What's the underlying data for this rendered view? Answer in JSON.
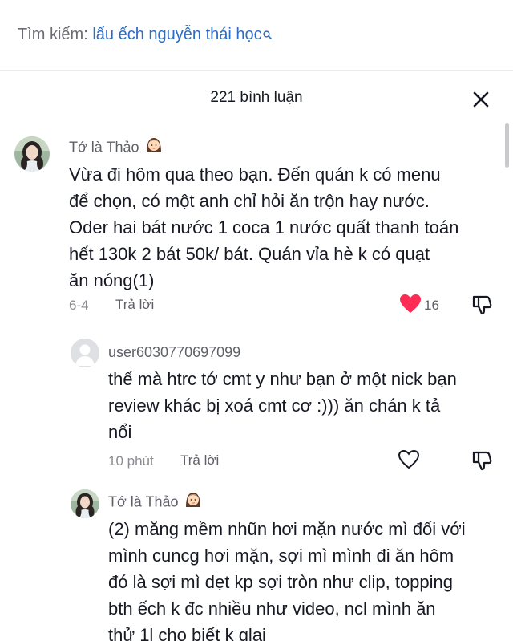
{
  "search": {
    "prefix": "Tìm kiếm: ",
    "query": "lẩu ếch nguyễn thái học",
    "icon": "search-icon"
  },
  "comments_sheet": {
    "title": "221 bình luận",
    "close_icon": "close-icon"
  },
  "comments": [
    {
      "author": "Tớ là Thảo",
      "author_badge_icon": "girl-face-emoji-icon",
      "text_lines": [
        "Vừa đi hôm qua theo bạn. Đến quán k có menu",
        "để chọn, có một anh chỉ hỏi ăn trộn hay nước.",
        "Oder hai bát nước 1 coca 1 nước quất thanh toán",
        "hết 130k 2 bát 50k/ bát. Quán vỉa hè k có quạt",
        "ăn nóng(1)"
      ],
      "date": "6-4",
      "reply_label": "Trả lời",
      "like_count": "16",
      "liked": true,
      "like_color": "#fe2c55"
    },
    {
      "author": "user6030770697099",
      "text_lines": [
        "thế mà htrc tớ cmt y như bạn ở một nick bạn",
        "review khác bị xoá cmt cơ :))) ăn chán k tả",
        "nổi"
      ],
      "date": "10 phút",
      "reply_label": "Trả lời",
      "liked": false
    },
    {
      "author": "Tớ là Thảo",
      "author_badge_icon": "girl-face-emoji-icon",
      "text_lines": [
        "(2) măng mềm nhũn hơi mặn nước mì đối với",
        "mình cuncg hơi mặn, sợi mì mình đi ăn hôm",
        "đó là sợi mì dẹt kp sợi tròn như clip, topping",
        "bth ếch k đc nhiều như video, ncl mình ăn",
        "thử 1l cho biết k qlai"
      ]
    }
  ]
}
